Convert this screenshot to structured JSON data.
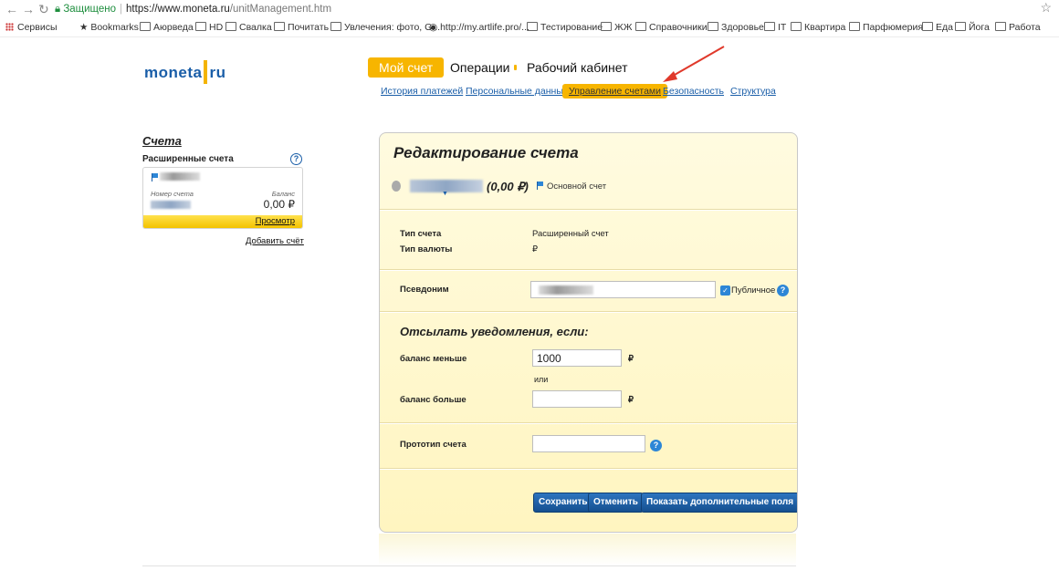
{
  "browser": {
    "secure_label": "Защищено",
    "url_host": "https://www.moneta.ru",
    "url_path": "/unitManagement.htm",
    "bookmarks": [
      "Сервисы",
      "Bookmarks",
      "Аюрведа",
      "HD",
      "Свалка",
      "Почитать",
      "Увлечения: фото, G...",
      "http://my.artlife.pro/...",
      "Тестирование",
      "ЖЖ",
      "Справочники",
      "Здоровье",
      "IT",
      "Квартира",
      "Парфюмерия",
      "Еда",
      "Йога",
      "Работа"
    ]
  },
  "site": {
    "logo_left": "moneta",
    "logo_right": "ru",
    "main_nav": [
      "Мой счет",
      "Операции",
      "Рабочий кабинет"
    ],
    "sub_nav": [
      "История платежей",
      "Персональные данные",
      "Управление счетами",
      "Безопасность",
      "Структура"
    ]
  },
  "sidebar": {
    "title": "Счета",
    "extended_label": "Расширенные счета",
    "help": "?",
    "card": {
      "number_label": "Номер счета",
      "balance_label": "Баланс",
      "balance": "0,00 ₽",
      "view_link": "Просмотр"
    },
    "add_account": "Добавить счёт"
  },
  "panel": {
    "title": "Редактирование счета",
    "account_amount": "(0,00 ₽)",
    "main_account": "Основной счет",
    "type_label": "Тип счета",
    "type_value": "Расширенный счет",
    "currency_label": "Тип валюты",
    "currency_value": "₽",
    "alias_label": "Псевдоним",
    "public_label": "Публичное",
    "notify_title": "Отсылать уведомления, если:",
    "balance_less_label": "баланс меньше",
    "balance_less_value": "1000",
    "or_label": "или",
    "balance_more_label": "баланс больше",
    "balance_more_value": "",
    "prototype_label": "Прототип счета",
    "prototype_value": "",
    "rub": "₽",
    "buttons": [
      "Сохранить",
      "Отменить",
      "Показать дополнительные поля"
    ]
  }
}
